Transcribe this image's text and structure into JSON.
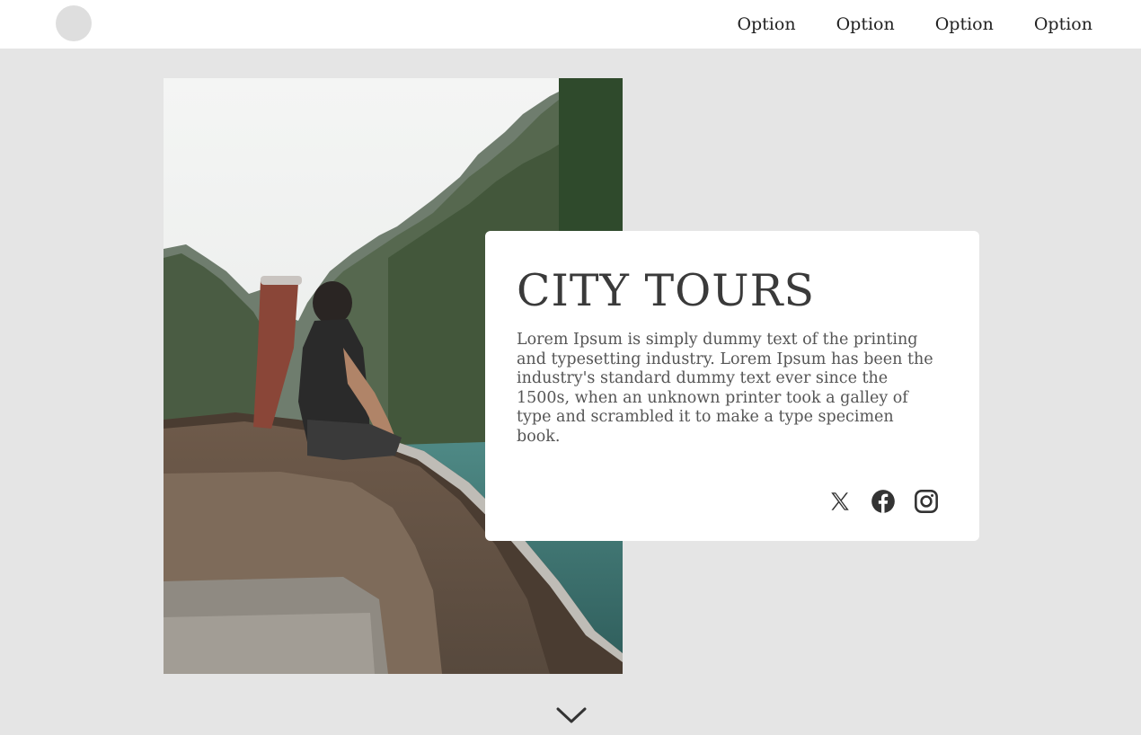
{
  "header": {
    "nav": [
      {
        "label": "Option"
      },
      {
        "label": "Option"
      },
      {
        "label": "Option"
      },
      {
        "label": "Option"
      }
    ]
  },
  "hero": {
    "image_icon": "boat-mountains-photo"
  },
  "card": {
    "title": "CITY TOURS",
    "body": "Lorem Ipsum is simply dummy text of the printing and typesetting industry. Lorem Ipsum has been the industry's standard  dummy text ever since the 1500s, when an unknown printer took a galley  of type and scrambled it to make a type specimen book.",
    "social": [
      {
        "icon": "x-icon"
      },
      {
        "icon": "facebook-icon"
      },
      {
        "icon": "instagram-icon"
      }
    ]
  },
  "colors": {
    "page_bg": "#e5e5e5",
    "header_bg": "#ffffff",
    "card_bg": "#ffffff",
    "text": "#3a3a3a"
  },
  "scroll": {
    "icon": "chevron-down-icon"
  }
}
